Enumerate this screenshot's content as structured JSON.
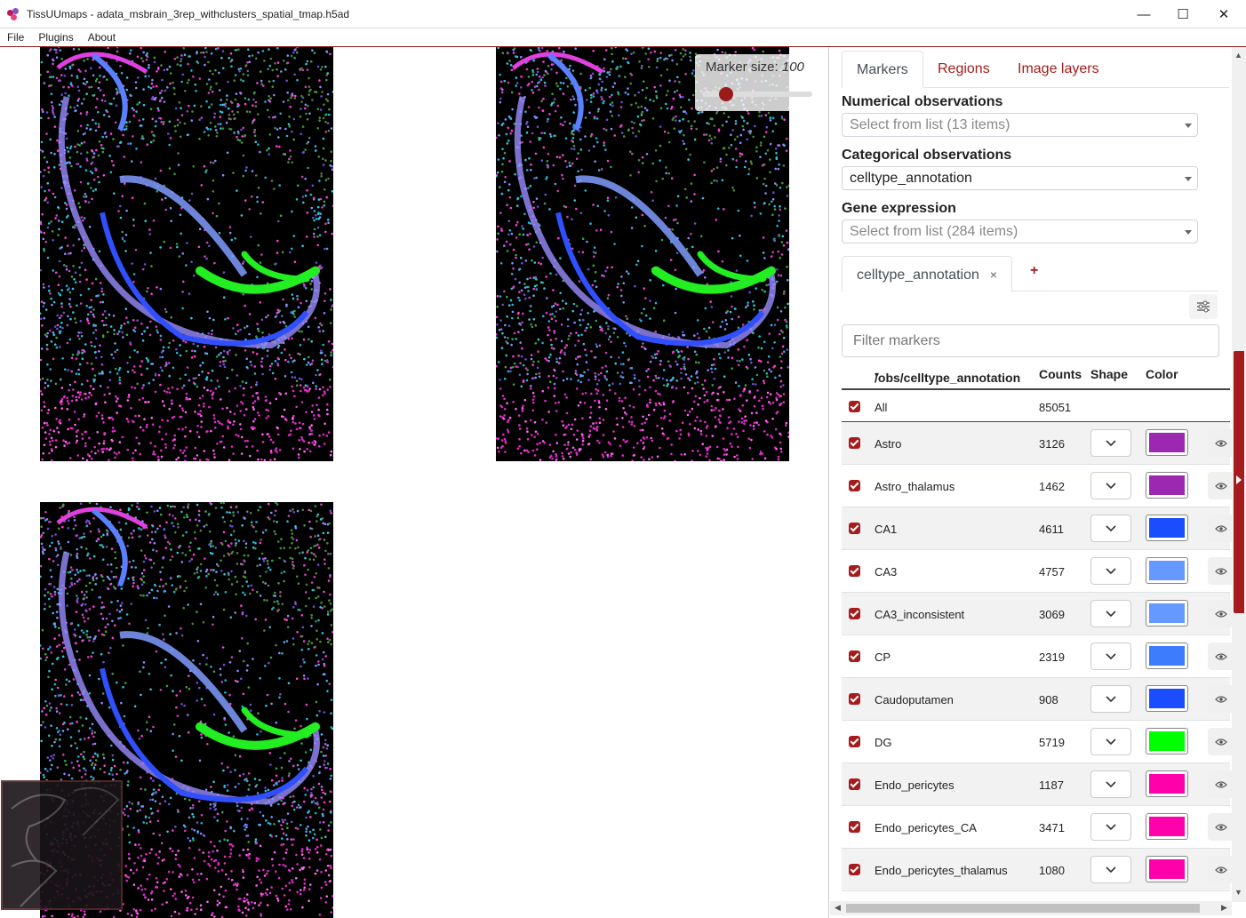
{
  "window": {
    "title": "TissUUmaps - adata_msbrain_3rep_withclusters_spatial_tmap.h5ad",
    "minimize": "—",
    "maximize": "☐",
    "close": "✕"
  },
  "menu": {
    "items": [
      "File",
      "Plugins",
      "About"
    ]
  },
  "viewer": {
    "marker_size_label": "Marker size:",
    "marker_size_value": "100",
    "marker_size_level": 100
  },
  "panel": {
    "tabs": [
      "Markers",
      "Regions",
      "Image layers"
    ],
    "numerical_label": "Numerical observations",
    "numerical_placeholder": "Select from list (13 items)",
    "categorical_label": "Categorical observations",
    "categorical_value": "celltype_annotation",
    "gene_label": "Gene expression",
    "gene_placeholder": "Select from list (284 items)",
    "subtab_label": "celltype_annotation",
    "subtab_close": "×",
    "add_tab": "+",
    "filter_placeholder": "Filter markers",
    "table": {
      "headers": {
        "name": "/obs/celltype_annotation",
        "sort": "▾",
        "counts": "Counts",
        "shape": "Shape",
        "color": "Color"
      },
      "all_label": "All",
      "all_count": "85051",
      "rows": [
        {
          "name": "Astro",
          "count": "3126",
          "color": "#9c27b0"
        },
        {
          "name": "Astro_thalamus",
          "count": "1462",
          "color": "#9c27b0"
        },
        {
          "name": "CA1",
          "count": "4611",
          "color": "#1a4dff"
        },
        {
          "name": "CA3",
          "count": "4757",
          "color": "#6699ff"
        },
        {
          "name": "CA3_inconsistent",
          "count": "3069",
          "color": "#6699ff"
        },
        {
          "name": "CP",
          "count": "2319",
          "color": "#3d7bff"
        },
        {
          "name": "Caudoputamen",
          "count": "908",
          "color": "#1a4dff"
        },
        {
          "name": "DG",
          "count": "5719",
          "color": "#00ff00"
        },
        {
          "name": "Endo_pericytes",
          "count": "1187",
          "color": "#ff00aa"
        },
        {
          "name": "Endo_pericytes_CA",
          "count": "3471",
          "color": "#ff00aa"
        },
        {
          "name": "Endo_pericytes_thalamus",
          "count": "1080",
          "color": "#ff00aa"
        }
      ]
    }
  },
  "colors": {
    "accent": "#a61b1b",
    "tab_text": "#a61b1b"
  }
}
